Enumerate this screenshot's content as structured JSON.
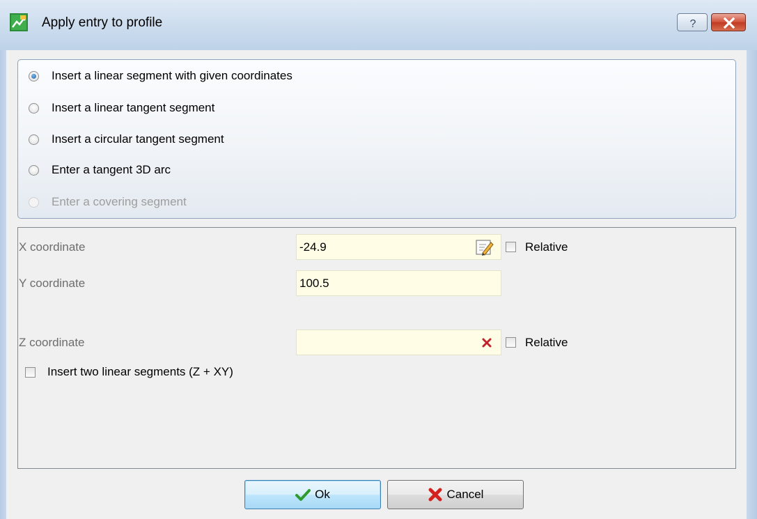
{
  "window": {
    "title": "Apply entry to profile",
    "help_glyph": "?",
    "close_glyph": "✕"
  },
  "options": [
    {
      "label": "Insert a linear segment with given coordinates",
      "checked": true,
      "enabled": true
    },
    {
      "label": "Insert a linear tangent segment",
      "checked": false,
      "enabled": true
    },
    {
      "label": "Insert a circular tangent segment",
      "checked": false,
      "enabled": true
    },
    {
      "label": "Enter a tangent 3D arc",
      "checked": false,
      "enabled": true
    },
    {
      "label": "Enter a covering segment",
      "checked": false,
      "enabled": false
    }
  ],
  "fields": {
    "x": {
      "label": "X coordinate",
      "value": "-24.9",
      "relative_label": "Relative",
      "relative_checked": false
    },
    "y": {
      "label": "Y coordinate",
      "value": "100.5"
    },
    "z": {
      "label": "Z coordinate",
      "value": "",
      "relative_label": "Relative",
      "relative_checked": false
    }
  },
  "two_segments": {
    "label": "Insert two linear segments (Z + XY)",
    "checked": false
  },
  "buttons": {
    "ok": "Ok",
    "cancel": "Cancel"
  },
  "colors": {
    "field_bg": "#fffde5",
    "title_bg": "#cbdcee",
    "close_red": "#c13a22"
  }
}
